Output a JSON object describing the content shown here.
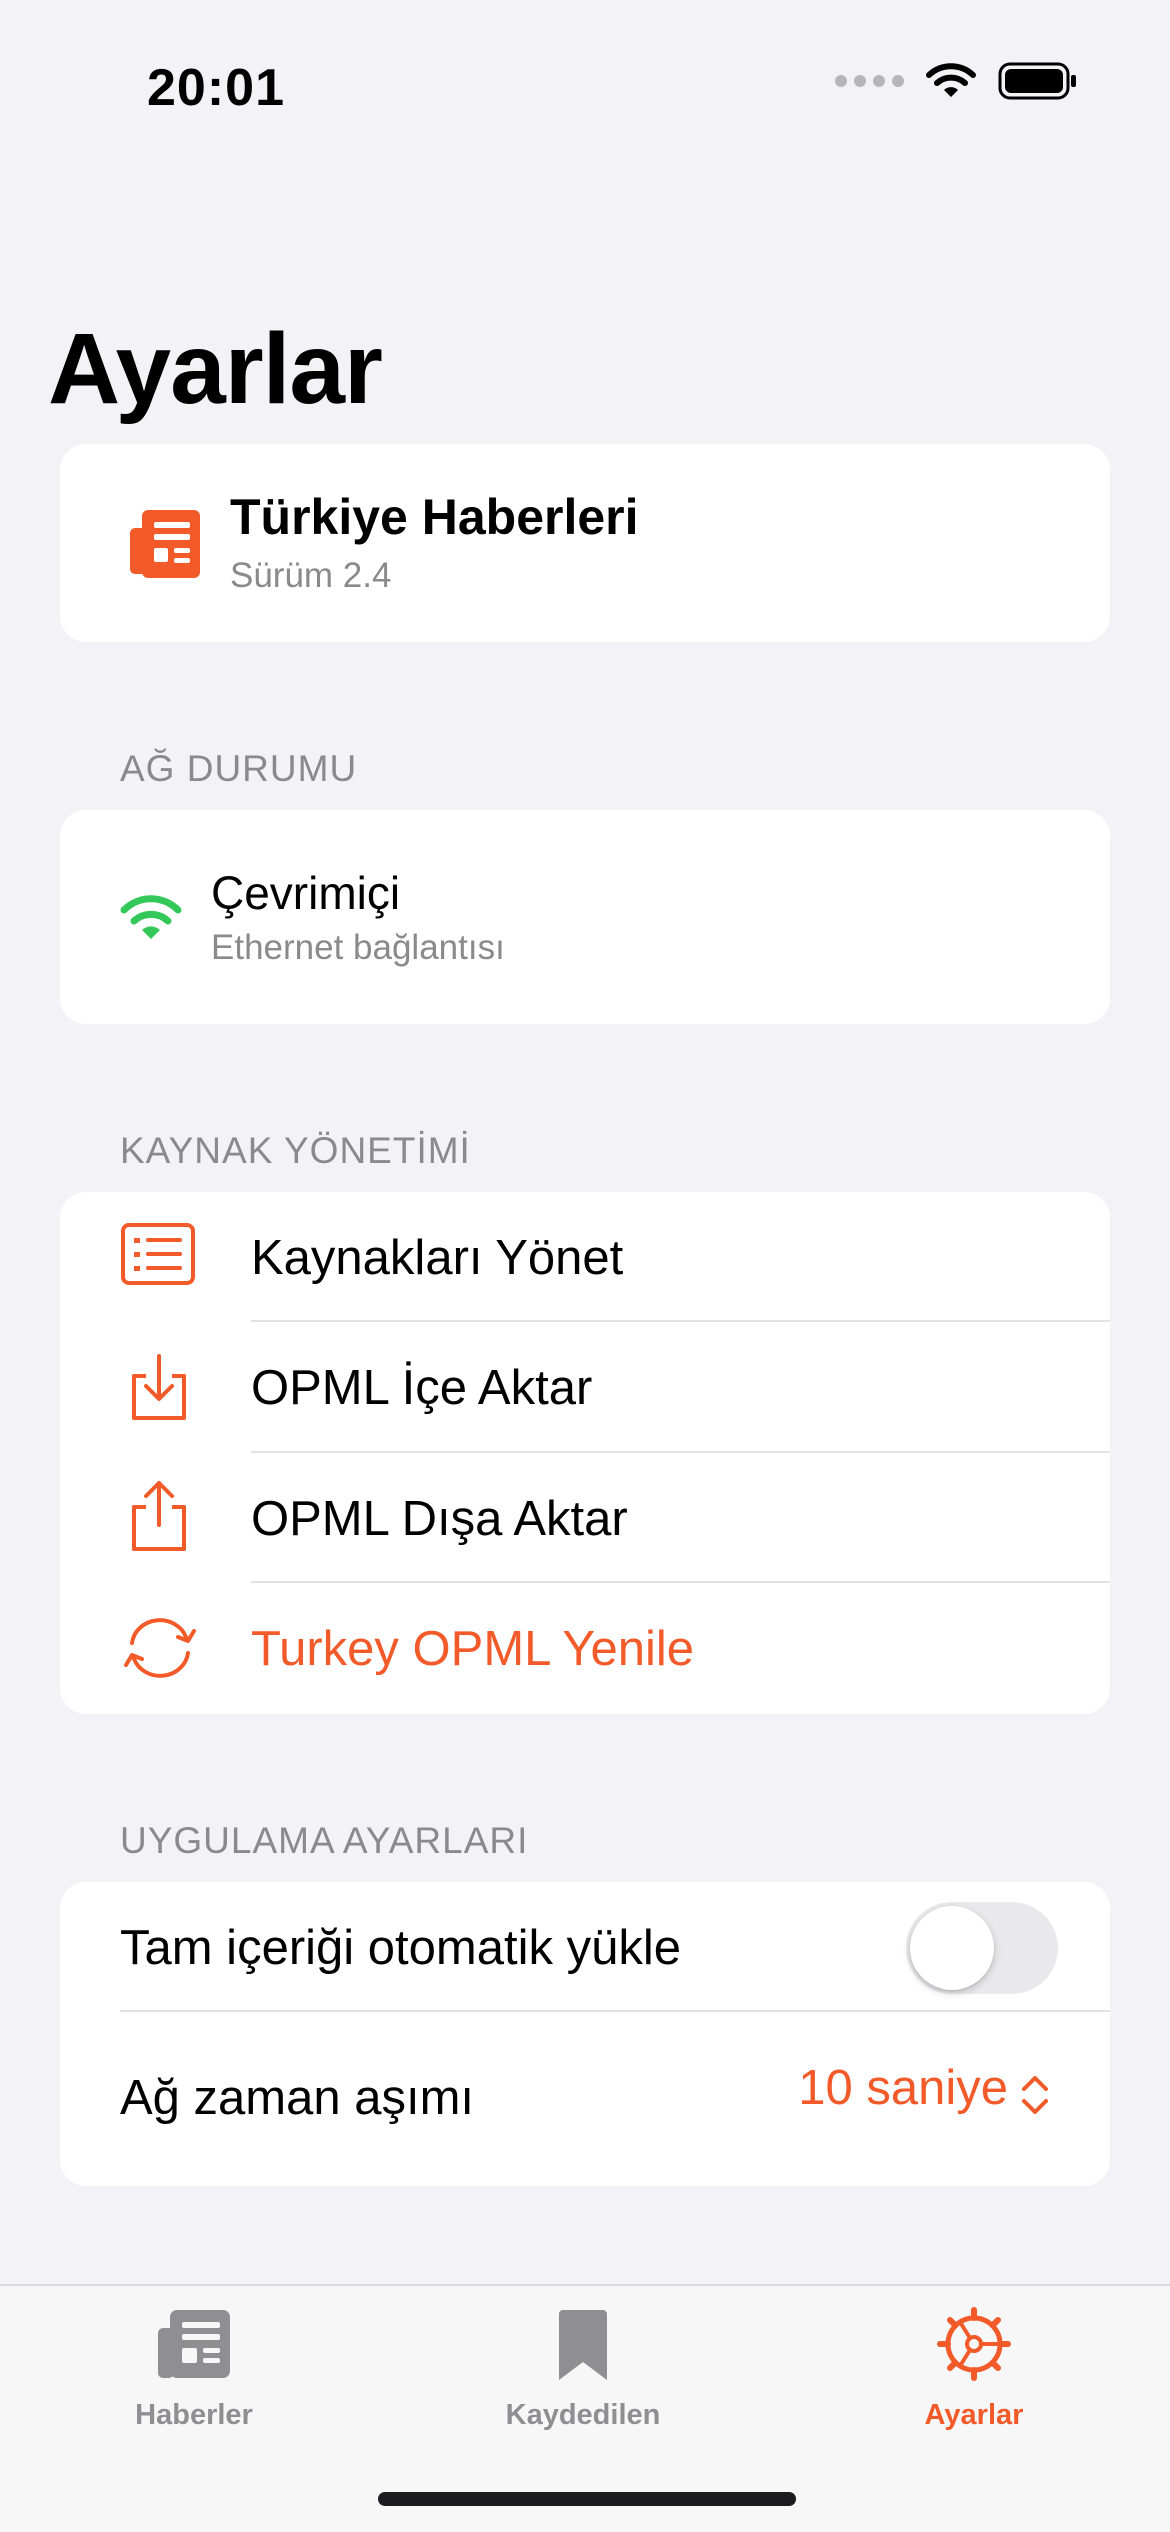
{
  "status_bar": {
    "time": "20:01"
  },
  "page_title": "Ayarlar",
  "app_info": {
    "name": "Türkiye Haberleri",
    "version": "Sürüm 2.4"
  },
  "network": {
    "header": "AĞ DURUMU",
    "status": "Çevrimiçi",
    "detail": "Ethernet bağlantısı"
  },
  "sources": {
    "header": "KAYNAK YÖNETİMİ",
    "items": [
      {
        "label": "Kaynakları Yönet",
        "icon": "list-icon"
      },
      {
        "label": "OPML İçe Aktar",
        "icon": "import-icon"
      },
      {
        "label": "OPML Dışa Aktar",
        "icon": "share-icon"
      },
      {
        "label": "Turkey OPML Yenile",
        "icon": "refresh-icon"
      }
    ]
  },
  "app_settings": {
    "header": "UYGULAMA AYARLARI",
    "autoload_label": "Tam içeriği otomatik yükle",
    "autoload_enabled": false,
    "timeout_label": "Ağ zaman aşımı",
    "timeout_value": "10 saniye"
  },
  "tabs": [
    {
      "label": "Haberler",
      "icon": "newspaper-icon",
      "active": false
    },
    {
      "label": "Kaydedilen",
      "icon": "bookmark-icon",
      "active": false
    },
    {
      "label": "Ayarlar",
      "icon": "gear-icon",
      "active": true
    }
  ],
  "colors": {
    "accent": "#f25a2a",
    "online": "#34c759",
    "background": "#f2f2f7",
    "secondary_text": "#8a8a8e"
  }
}
